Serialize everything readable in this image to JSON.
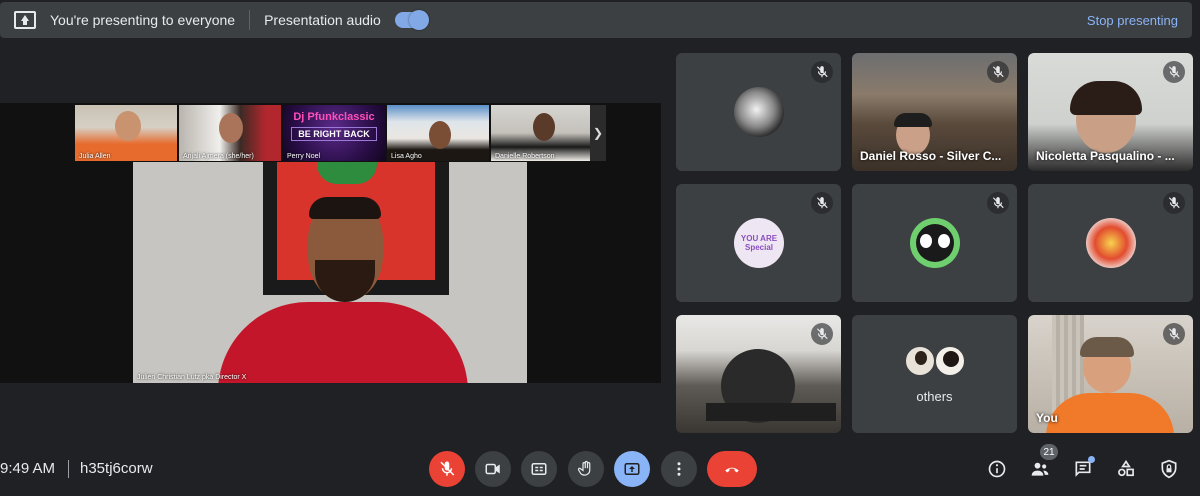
{
  "presenting_bar": {
    "status_text": "You're presenting to everyone",
    "audio_label": "Presentation audio",
    "audio_enabled": true,
    "stop_label": "Stop presenting"
  },
  "presentation": {
    "thumbnails": [
      {
        "name": "Julia Allen"
      },
      {
        "name": "Anjali Ajmera (she/her)"
      },
      {
        "name": "Perry Noel",
        "title": "Dj Pfunkclassic",
        "subtitle": "BE RIGHT BACK"
      },
      {
        "name": "Lisa Agho"
      },
      {
        "name": "Danielle Robertson"
      }
    ],
    "main_speaker": "Julien Christian Lutz pka Director X"
  },
  "participants": [
    {
      "name": "",
      "muted": true
    },
    {
      "name": "Daniel Rosso - Silver C...",
      "muted": true
    },
    {
      "name": "Nicoletta Pasqualino - ...",
      "muted": true
    },
    {
      "name": "",
      "muted": true,
      "avatar_text": "YOU ARE Special"
    },
    {
      "name": "",
      "muted": true
    },
    {
      "name": "",
      "muted": true
    },
    {
      "name": "",
      "muted": true
    },
    {
      "name": "others",
      "muted": false
    },
    {
      "name": "You",
      "muted": true
    }
  ],
  "bottom_bar": {
    "time": "9:49 AM",
    "meeting_code": "h35tj6corw",
    "people_count": "21"
  },
  "colors": {
    "background": "#202124",
    "tile": "#3c4043",
    "accent_blue": "#8ab4f8",
    "danger_red": "#ea4335"
  }
}
